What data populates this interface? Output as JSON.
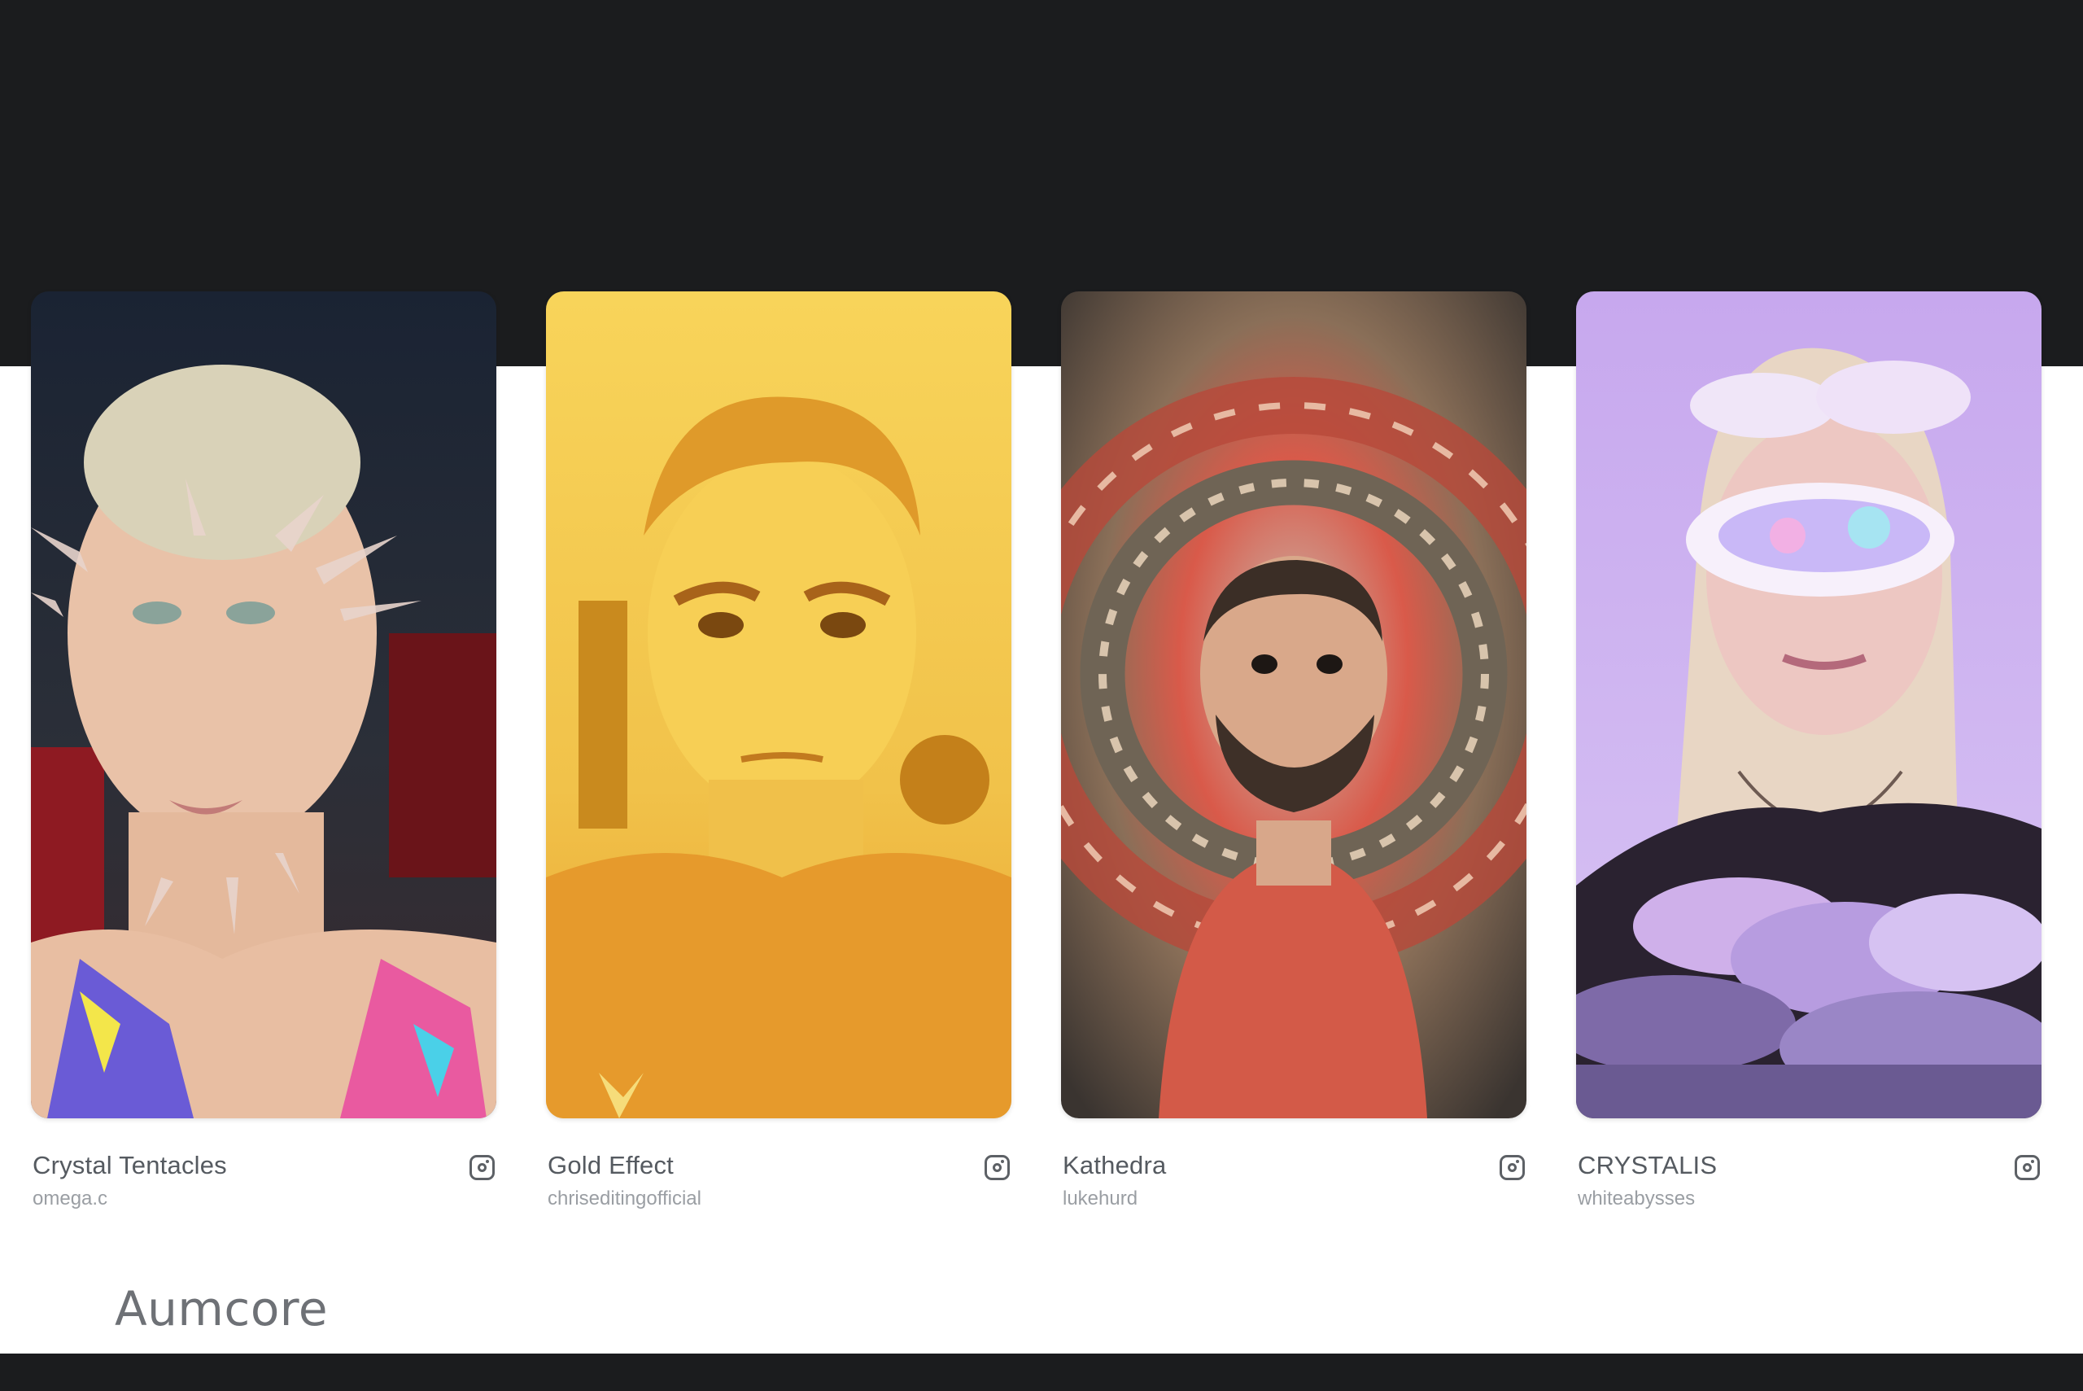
{
  "cards": [
    {
      "title": "Crystal Tentacles",
      "author": "omega.c",
      "icon": "instagram-icon"
    },
    {
      "title": "Gold Effect",
      "author": "chriseditingofficial",
      "icon": "instagram-icon"
    },
    {
      "title": "Kathedra",
      "author": "lukehurd",
      "icon": "instagram-icon"
    },
    {
      "title": "CRYSTALIS",
      "author": "whiteabysses",
      "icon": "instagram-icon"
    }
  ],
  "footer": {
    "brand": "Aumcore"
  },
  "colors": {
    "dark_band": "#1b1c1e",
    "title_text": "#555a60",
    "author_text": "#9a9ea3"
  }
}
